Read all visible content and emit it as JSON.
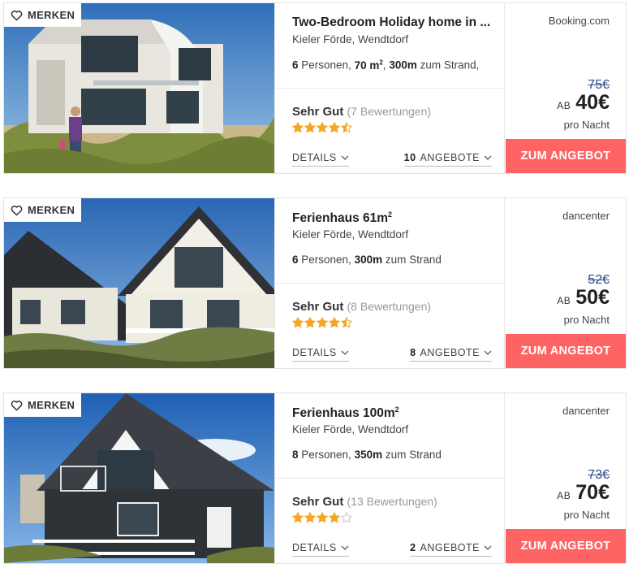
{
  "accent_color": "#ff6464",
  "price_old_color": "#2b4b87",
  "star_color": "#f5a623",
  "listings": [
    {
      "merken_label": "MERKEN",
      "title": "Two-Bedroom Holiday home in ...",
      "location": "Kieler Förde, Wendtdorf",
      "persons": "6",
      "persons_label": " Personen, ",
      "area": "70 m",
      "area_sup": "2",
      "area_sep": ", ",
      "beach_distance": "300m",
      "beach_label": " zum Strand,",
      "rating_label": "Sehr Gut",
      "rating_count": "(7 Bewertungen)",
      "stars": 4.5,
      "details_label": "DETAILS",
      "offers_count": "10",
      "offers_label": "ANGEBOTE",
      "provider": "Booking.com",
      "price_old": "75€",
      "price_prefix": "AB",
      "price_new": "40€",
      "price_unit": "pro Nacht",
      "cta_label": "ZUM ANGEBOT"
    },
    {
      "merken_label": "MERKEN",
      "title": "Ferienhaus 61m",
      "title_sup": "2",
      "location": "Kieler Förde, Wendtdorf",
      "persons": "6",
      "persons_label": " Personen, ",
      "beach_distance": "300m",
      "beach_label": " zum Strand",
      "rating_label": "Sehr Gut",
      "rating_count": "(8 Bewertungen)",
      "stars": 4.5,
      "details_label": "DETAILS",
      "offers_count": "8",
      "offers_label": "ANGEBOTE",
      "provider": "dancenter",
      "price_old": "52€",
      "price_prefix": "AB",
      "price_new": "50€",
      "price_unit": "pro Nacht",
      "cta_label": "ZUM ANGEBOT"
    },
    {
      "merken_label": "MERKEN",
      "title": "Ferienhaus 100m",
      "title_sup": "2",
      "location": "Kieler Förde, Wendtdorf",
      "persons": "8",
      "persons_label": " Personen, ",
      "beach_distance": "350m",
      "beach_label": " zum Strand",
      "rating_label": "Sehr Gut",
      "rating_count": "(13 Bewertungen)",
      "stars": 4,
      "details_label": "DETAILS",
      "offers_count": "2",
      "offers_label": "ANGEBOTE",
      "provider": "dancenter",
      "price_old": "73€",
      "price_prefix": "AB",
      "price_new": "70€",
      "price_unit": "pro Nacht",
      "cta_label": "ZUM ANGEBOT"
    }
  ]
}
